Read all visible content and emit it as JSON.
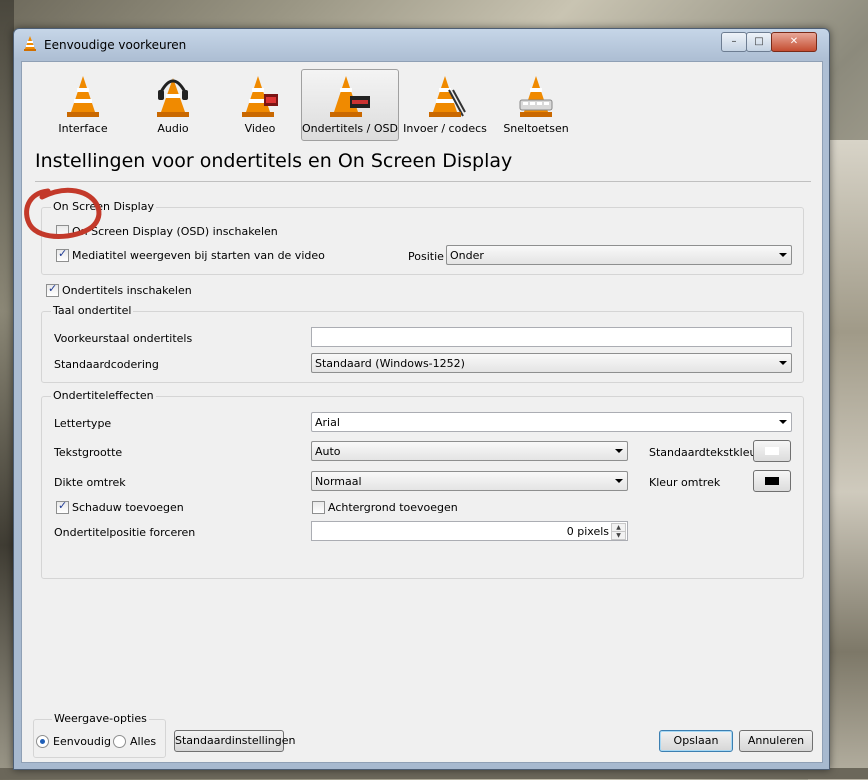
{
  "window": {
    "title": "Eenvoudige voorkeuren",
    "close": "✕",
    "minimize": "–",
    "maximize": "□"
  },
  "categories": [
    {
      "label": "Interface",
      "icon": "cone-interface-icon"
    },
    {
      "label": "Audio",
      "icon": "cone-headphones-icon"
    },
    {
      "label": "Video",
      "icon": "cone-video-icon"
    },
    {
      "label": "Ondertitels / OSD",
      "icon": "cone-subtitles-icon",
      "active": true
    },
    {
      "label": "Invoer / codecs",
      "icon": "cone-codecs-icon"
    },
    {
      "label": "Sneltoetsen",
      "icon": "cone-hotkeys-icon"
    }
  ],
  "section_title": "Instellingen voor ondertitels en On Screen Display",
  "osd": {
    "group_title": "On Screen Display",
    "enable_osd": {
      "label": "On Screen Display (OSD) inschakelen",
      "checked": false
    },
    "show_title": {
      "label": "Mediatitel weergeven bij starten van de video",
      "checked": true
    },
    "position_label": "Positie",
    "position_value": "Onder"
  },
  "subtitles_enable": {
    "label": "Ondertitels inschakelen",
    "checked": true
  },
  "language": {
    "group_title": "Taal ondertitel",
    "preferred_label": "Voorkeurstaal ondertitels",
    "preferred_value": "",
    "encoding_label": "Standaardcodering",
    "encoding_value": "Standaard (Windows-1252)"
  },
  "effects": {
    "group_title": "Ondertiteleffecten",
    "font_label": "Lettertype",
    "font_value": "Arial",
    "size_label": "Tekstgrootte",
    "size_value": "Auto",
    "text_color_label": "Standaardtekstkleur",
    "text_color": "#ffffff",
    "outline_label": "Dikte omtrek",
    "outline_value": "Normaal",
    "outline_color_label": "Kleur omtrek",
    "outline_color": "#000000",
    "shadow": {
      "label": "Schaduw toevoegen",
      "checked": true
    },
    "background": {
      "label": "Achtergrond toevoegen",
      "checked": false
    },
    "force_pos_label": "Ondertitelpositie forceren",
    "force_pos_value": "0 pixels"
  },
  "view": {
    "group_title": "Weergave-opties",
    "simple": {
      "label": "Eenvoudig",
      "checked": true
    },
    "all": {
      "label": "Alles",
      "checked": false
    }
  },
  "buttons": {
    "defaults": "Standaardinstellingen",
    "save": "Opslaan",
    "cancel": "Annuleren"
  }
}
